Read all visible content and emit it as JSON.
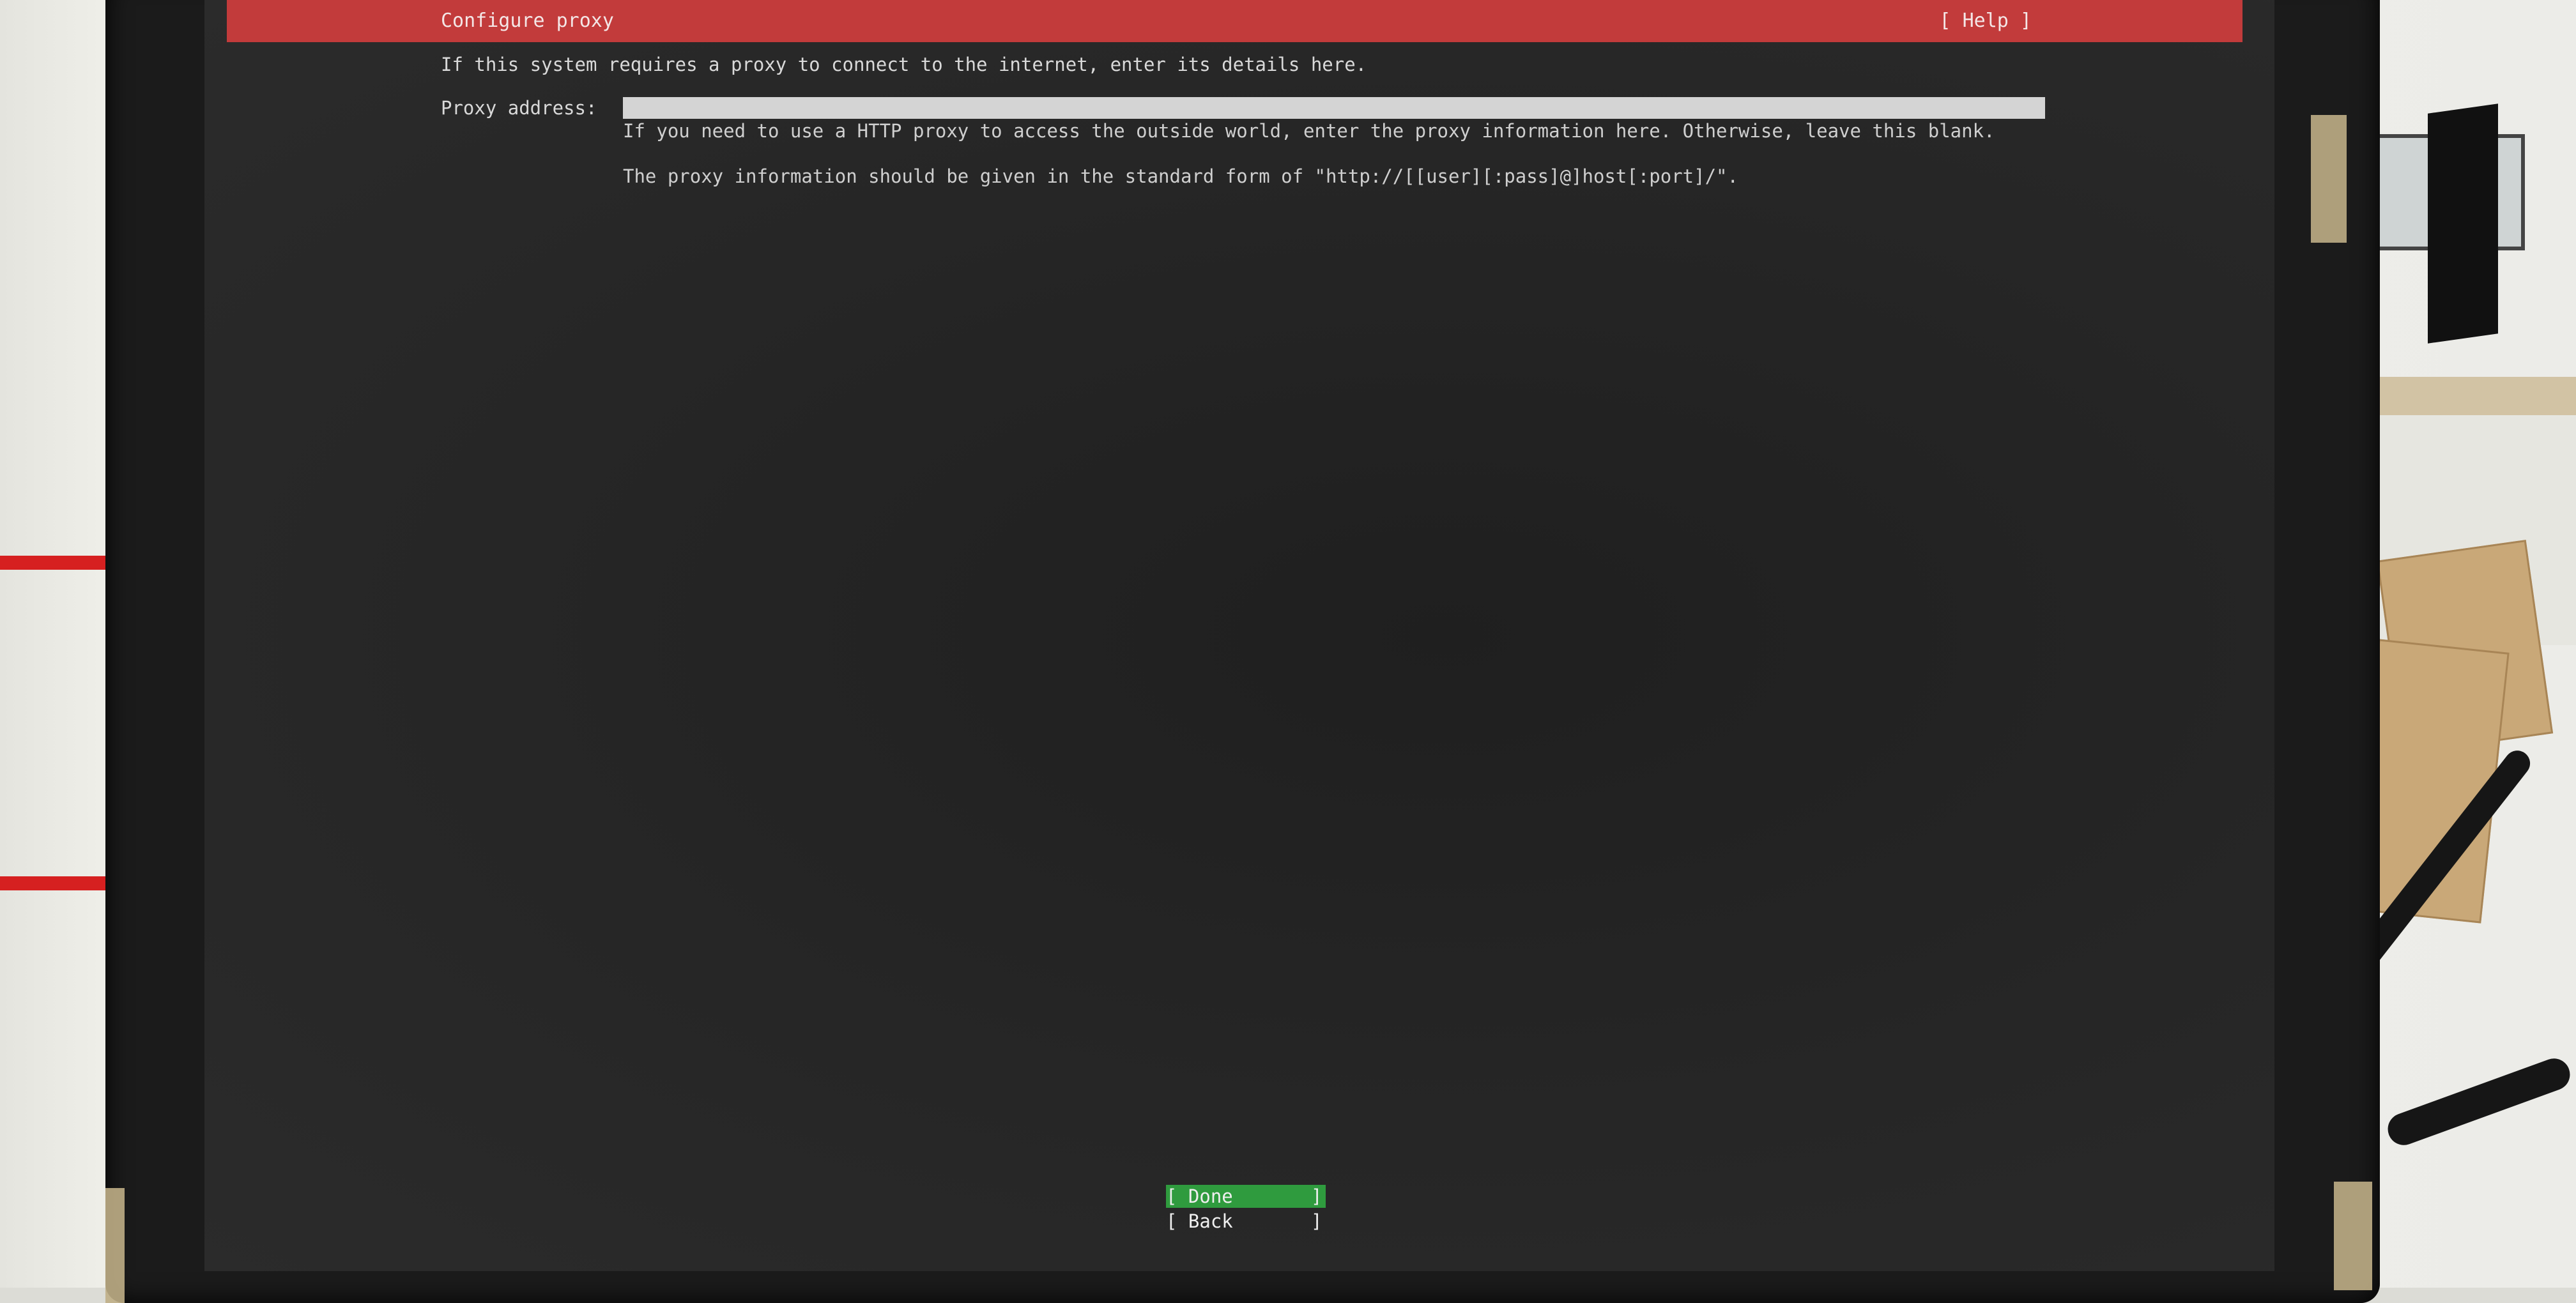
{
  "window": {
    "title": "Configure proxy",
    "help_label": "[ Help ]"
  },
  "form": {
    "intro": "If this system requires a proxy to connect to the internet, enter its details here.",
    "proxy_label": "Proxy address:",
    "proxy_value": "",
    "hint_line1": "If you need to use a HTTP proxy to access the outside world, enter the proxy information here. Otherwise, leave this blank.",
    "hint_line2": "The proxy information should be given in the standard form of \"http://[[user][:pass]@]host[:port]/\"."
  },
  "buttons": {
    "done_label": "[ Done       ]",
    "back_label": "[ Back       ]"
  },
  "colors": {
    "titlebar": "#c23b3b",
    "selected_button": "#2f9b3e",
    "screen_bg": "#262626"
  }
}
